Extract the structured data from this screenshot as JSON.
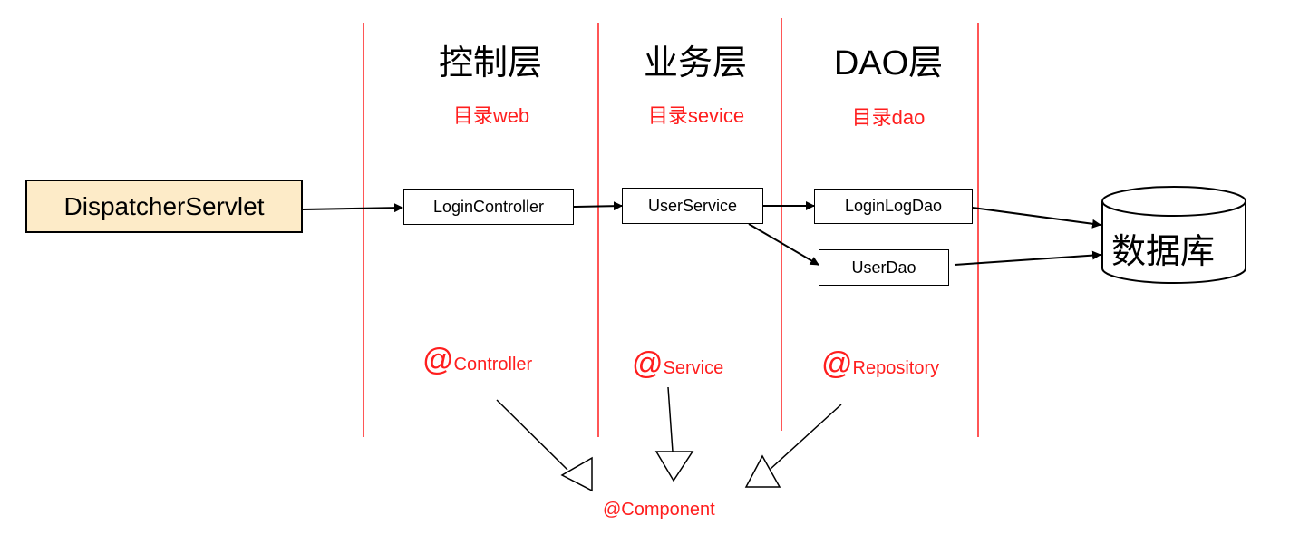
{
  "layers": [
    {
      "title": "控制层",
      "directory": "目录web",
      "annotation_symbol": "@",
      "annotation_name": "Controller"
    },
    {
      "title": "业务层",
      "directory": "目录sevice",
      "annotation_symbol": "@",
      "annotation_name": "Service"
    },
    {
      "title": "DAO层",
      "directory": "目录dao",
      "annotation_symbol": "@",
      "annotation_name": "Repository"
    }
  ],
  "nodes": {
    "dispatcher": "DispatcherServlet",
    "login_controller": "LoginController",
    "user_service": "UserService",
    "login_log_dao": "LoginLogDao",
    "user_dao": "UserDao",
    "database": "数据库"
  },
  "component_annotation": "@Component",
  "colors": {
    "divider": "#ff1e1e",
    "annotation_text": "#ff1e1e",
    "dispatcher_fill": "#fdebc8",
    "box_border": "#000000"
  }
}
